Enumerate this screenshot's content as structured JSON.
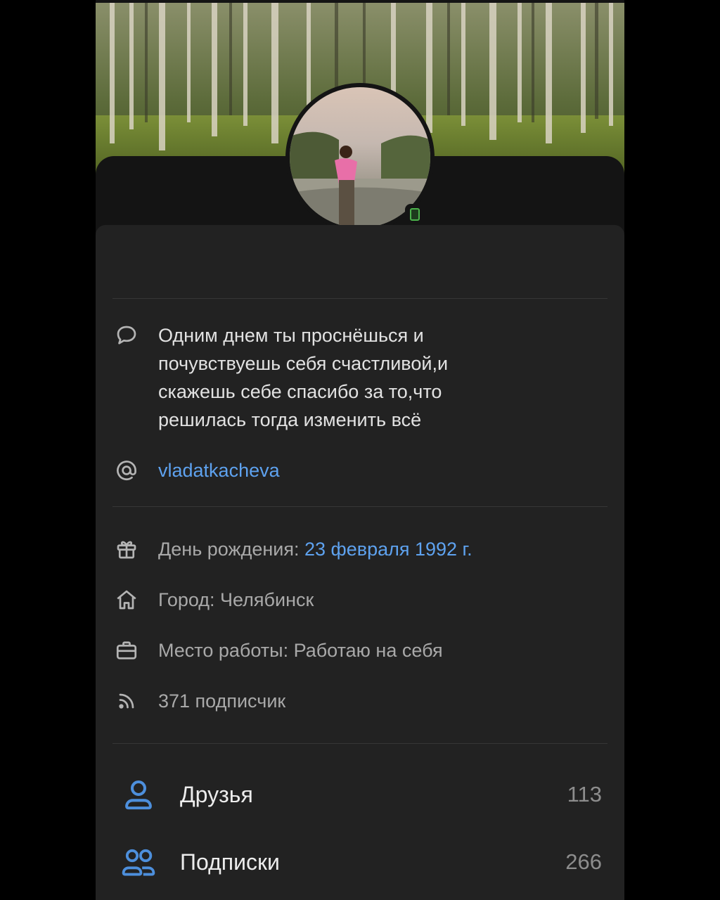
{
  "profile": {
    "bio": "Одним днем ты проснёшься и почувствуешь себя счастливой,и скажешь себе спасибо за то,что решилась тогда изменить всё",
    "username": "vladatkacheva",
    "birthday_label": "День рождения: ",
    "birthday_value": "23 февраля 1992 г.",
    "city": "Город: Челябинск",
    "work": "Место работы: Работаю на себя",
    "followers": "371 подписчик"
  },
  "stats": [
    {
      "label": "Друзья",
      "count": "113",
      "icon": "user-icon"
    },
    {
      "label": "Подписки",
      "count": "266",
      "icon": "users-icon"
    }
  ],
  "colors": {
    "accent": "#5ea2ef",
    "card": "#222222",
    "online": "#4bb34b"
  }
}
